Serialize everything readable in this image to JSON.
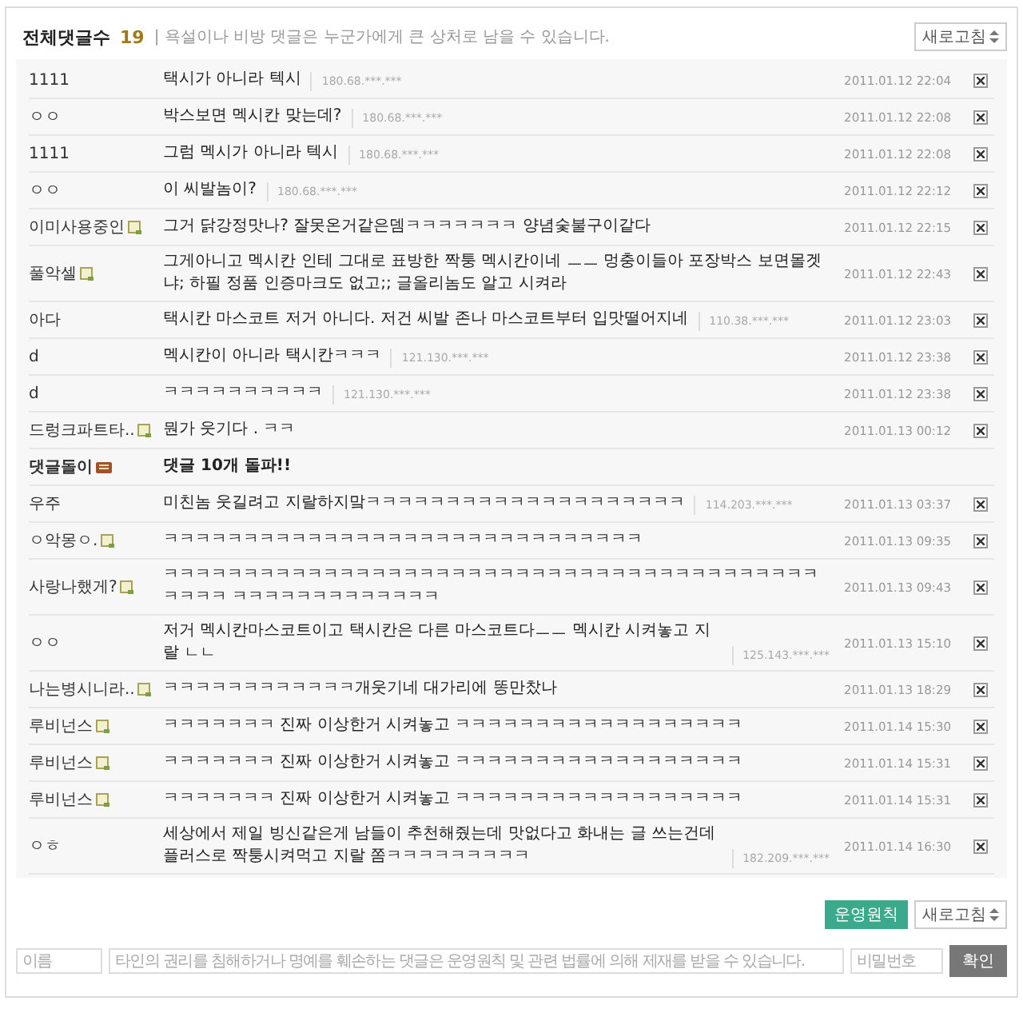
{
  "header": {
    "title": "전체댓글수",
    "count": "19",
    "notice": "| 욕설이나 비방 댓글은 누군가에게 큰 상처로 남을 수 있습니다.",
    "refresh": "새로고침"
  },
  "comments": [
    {
      "kind": "comment",
      "author": "1111",
      "member": false,
      "text": "택시가 아니라 텍시",
      "ip": "180.68.***.***",
      "date": "2011.01.12 22:04"
    },
    {
      "kind": "comment",
      "author": "ㅇㅇ",
      "member": false,
      "text": "박스보면 멕시칸 맞는데?",
      "ip": "180.68.***.***",
      "date": "2011.01.12 22:08"
    },
    {
      "kind": "comment",
      "author": "1111",
      "member": false,
      "text": "그럼 멕시가 아니라 텍시",
      "ip": "180.68.***.***",
      "date": "2011.01.12 22:08"
    },
    {
      "kind": "comment",
      "author": "ㅇㅇ",
      "member": false,
      "text": "이 씨발놈이?",
      "ip": "180.68.***.***",
      "date": "2011.01.12 22:12"
    },
    {
      "kind": "comment",
      "author": "이미사용중인",
      "member": true,
      "text": "그거 닭강정맛나? 잘못온거같은뎀ㅋㅋㅋㅋㅋㅋㅋ 양념숯불구이같다",
      "date": "2011.01.12 22:15"
    },
    {
      "kind": "comment",
      "author": "풀악셀",
      "member": true,
      "text": "그게아니고 멕시칸 인테 그대로 표방한 짝퉁 멕시칸이네 ㅡㅡ 멍충이들아 포장박스 보면몰겟냐; 하필 정품 인증마크도 없고;; 글올리놈도 알고 시켜라",
      "date": "2011.01.12 22:43"
    },
    {
      "kind": "comment",
      "author": "아다",
      "member": false,
      "text": "택시칸 마스코트 저거 아니다. 저건 씨발 존나 마스코트부터 입맛떨어지네",
      "ip": "110.38.***.***",
      "date": "2011.01.12 23:03"
    },
    {
      "kind": "comment",
      "author": "d",
      "member": false,
      "text": "멕시칸이 아니라 택시칸ㅋㅋㅋ",
      "ip": "121.130.***.***",
      "date": "2011.01.12 23:38"
    },
    {
      "kind": "comment",
      "author": "d",
      "member": false,
      "text": "ㅋㅋㅋㅋㅋㅋㅋㅋㅋㅋ",
      "ip": "121.130.***.***",
      "date": "2011.01.12 23:38"
    },
    {
      "kind": "comment",
      "author": "드렁크파트타..",
      "member": true,
      "text": "뭔가 웃기다 . ㅋㅋ",
      "date": "2011.01.13 00:12"
    },
    {
      "kind": "notice",
      "author": "댓글돌이",
      "text": "댓글 10개 돌파!!"
    },
    {
      "kind": "comment",
      "author": "우주",
      "member": false,
      "text": "미친놈 웃길려고 지랄하지맠ㅋㅋㅋㅋㅋㅋㅋㅋㅋㅋㅋㅋㅋㅋㅋㅋㅋㅋㅋㅋ",
      "ip": "114.203.***.***",
      "date": "2011.01.13 03:37"
    },
    {
      "kind": "comment",
      "author": "ㅇ악몽ㅇ.",
      "member": true,
      "text": "ㅋㅋㅋㅋㅋㅋㅋㅋㅋㅋㅋㅋㅋㅋㅋㅋㅋㅋㅋㅋㅋㅋㅋㅋㅋㅋㅋㅋㅋㅋ",
      "date": "2011.01.13 09:35"
    },
    {
      "kind": "comment",
      "author": "사랑나했게?",
      "member": true,
      "text": "ㅋㅋㅋㅋㅋㅋㅋㅋㅋㅋㅋㅋㅋㅋㅋㅋㅋㅋㅋㅋㅋㅋㅋㅋㅋㅋㅋㅋㅋㅋㅋㅋㅋㅋㅋㅋㅋㅋㅋㅋㅋㅋㅋㅋㅋ ㅋㅋㅋㅋㅋㅋㅋㅋㅋㅋㅋㅋㅋ",
      "date": "2011.01.13 09:43"
    },
    {
      "kind": "comment",
      "author": "ㅇㅇ",
      "member": false,
      "text": "저거 멕시칸마스코트이고 택시칸은 다른 마스코트다ㅡㅡ 멕시칸 시켜놓고 지랄 ㄴㄴ",
      "ip": "125.143.***.***",
      "date": "2011.01.13 15:10"
    },
    {
      "kind": "comment",
      "author": "나는병시니라..",
      "member": true,
      "text": "ㅋㅋㅋㅋㅋㅋㅋㅋㅋㅋㅋㅋ개웃기네 대가리에 똥만찼나",
      "date": "2011.01.13 18:29"
    },
    {
      "kind": "comment",
      "author": "루비넌스",
      "member": true,
      "text": "ㅋㅋㅋㅋㅋㅋㅋ 진짜 이상한거 시켜놓고 ㅋㅋㅋㅋㅋㅋㅋㅋㅋㅋㅋㅋㅋㅋㅋㅋㅋㅋ",
      "date": "2011.01.14 15:30"
    },
    {
      "kind": "comment",
      "author": "루비넌스",
      "member": true,
      "text": "ㅋㅋㅋㅋㅋㅋㅋ 진짜 이상한거 시켜놓고 ㅋㅋㅋㅋㅋㅋㅋㅋㅋㅋㅋㅋㅋㅋㅋㅋㅋㅋ",
      "date": "2011.01.14 15:31"
    },
    {
      "kind": "comment",
      "author": "루비넌스",
      "member": true,
      "text": "ㅋㅋㅋㅋㅋㅋㅋ 진짜 이상한거 시켜놓고 ㅋㅋㅋㅋㅋㅋㅋㅋㅋㅋㅋㅋㅋㅋㅋㅋㅋㅋ",
      "date": "2011.01.14 15:31"
    },
    {
      "kind": "comment",
      "author": "ㅇㅎ",
      "member": false,
      "text": "세상에서 제일 빙신같은게 남들이 추천해줬는데 맛없다고 화내는 글 쓰는건데 플러스로 짝퉁시켜먹고 지랄 쫌ㅋㅋㅋㅋㅋㅋㅋㅋㅋ",
      "ip": "182.209.***.***",
      "date": "2011.01.14 16:30"
    }
  ],
  "footer": {
    "rules": "운영원칙",
    "refresh": "새로고침"
  },
  "form": {
    "name": {
      "placeholder": "이름"
    },
    "body": {
      "placeholder": "타인의 권리를 침해하거나 명예를 훼손하는 댓글은 운영원칙 및 관련 법률에 의해 제재를 받을 수 있습니다."
    },
    "password": {
      "placeholder": "비밀번호"
    },
    "submit": "확인"
  }
}
